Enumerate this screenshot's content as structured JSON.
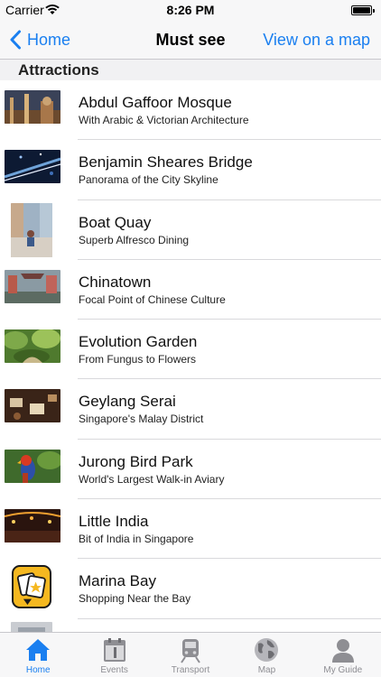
{
  "status_bar": {
    "carrier": "Carrier",
    "time": "8:26 PM"
  },
  "nav": {
    "back_label": "Home",
    "title": "Must see",
    "map_label": "View on a map"
  },
  "section": {
    "title": "Attractions"
  },
  "items": [
    {
      "title": "Abdul Gaffoor Mosque",
      "subtitle": "With Arabic & Victorian Architecture",
      "thumb": "mosque-photo"
    },
    {
      "title": "Benjamin Sheares Bridge",
      "subtitle": "Panorama of the City Skyline",
      "thumb": "bridge-photo"
    },
    {
      "title": "Boat Quay",
      "subtitle": "Superb Alfresco Dining",
      "thumb": "quay-photo"
    },
    {
      "title": "Chinatown",
      "subtitle": "Focal Point of Chinese Culture",
      "thumb": "chinatown-photo"
    },
    {
      "title": "Evolution Garden",
      "subtitle": "From Fungus to Flowers",
      "thumb": "garden-photo"
    },
    {
      "title": "Geylang Serai",
      "subtitle": "Singapore's Malay District",
      "thumb": "geylang-photo"
    },
    {
      "title": "Jurong Bird Park",
      "subtitle": "World's Largest Walk-in Aviary",
      "thumb": "bird-photo"
    },
    {
      "title": "Little India",
      "subtitle": "Bit of India in Singapore",
      "thumb": "little-india-photo"
    },
    {
      "title": "Marina Bay",
      "subtitle": "Shopping Near the Bay",
      "thumb": "placeholder-icon"
    }
  ],
  "tabs": [
    {
      "label": "Home",
      "icon": "home-icon",
      "active": true
    },
    {
      "label": "Events",
      "icon": "calendar-icon",
      "active": false
    },
    {
      "label": "Transport",
      "icon": "train-icon",
      "active": false
    },
    {
      "label": "Map",
      "icon": "globe-icon",
      "active": false
    },
    {
      "label": "My Guide",
      "icon": "person-icon",
      "active": false
    }
  ],
  "colors": {
    "accent": "#1a7ff0",
    "tab_inactive": "#8e8e93",
    "bar_background": "#f7f7f8"
  }
}
